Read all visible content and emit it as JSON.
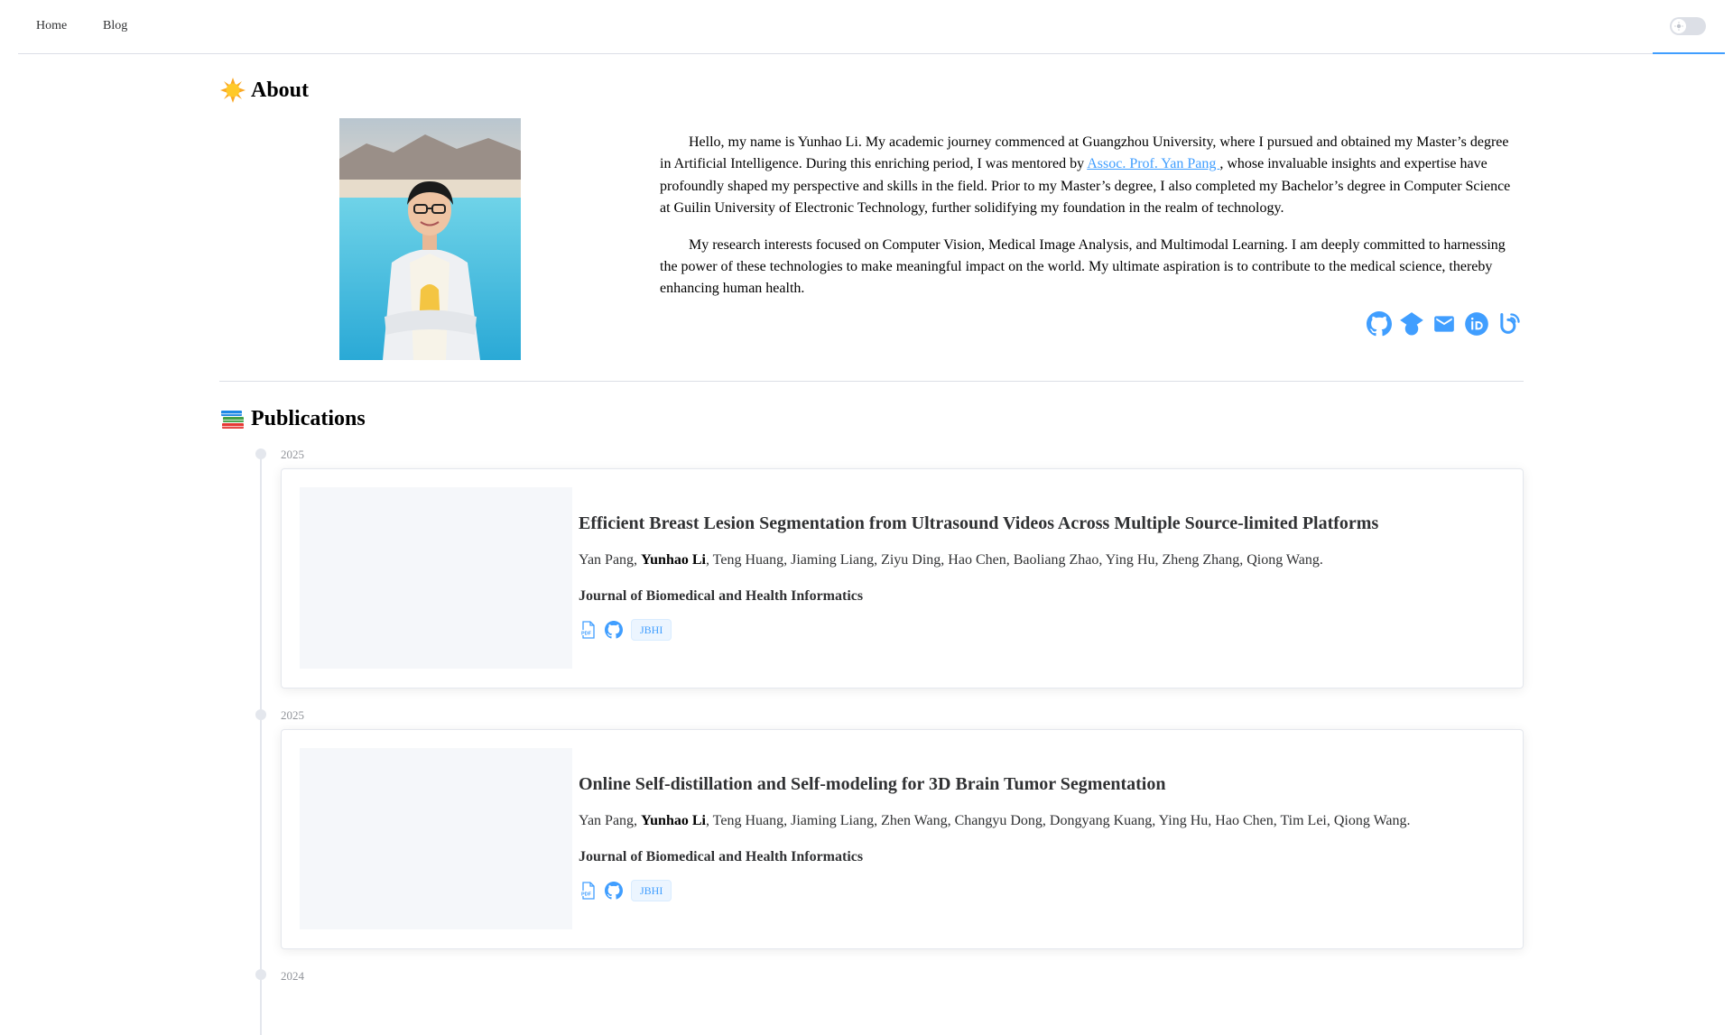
{
  "nav": {
    "home_label": "Home",
    "blog_label": "Blog"
  },
  "colors": {
    "accent": "#409eff",
    "border": "#dcdfe6",
    "text": "#303133",
    "muted": "#909399"
  },
  "about": {
    "title": "About",
    "title_emoji": "sun-with-face-icon",
    "paragraph_1_before_link": "Hello, my name is Yunhao Li. My academic journey commenced at Guangzhou University, where I pursued and obtained my Master’s degree in Artificial Intelligence. During this enriching period, I was mentored by ",
    "mentor_link": "Assoc. Prof. Yan Pang ",
    "paragraph_1_after_link": ", whose invaluable insights and expertise have profoundly shaped my perspective and skills in the field. Prior to my Master’s degree, I also completed my Bachelor’s degree in Computer Science at Guilin University of Electronic Technology, further solidifying my foundation in the realm of technology.",
    "paragraph_2": "My research interests focused on Computer Vision, Medical Image Analysis, and Multimodal Learning. I am deeply committed to harnessing the power of these technologies to make meaningful impact on the world. My ultimate aspiration is to contribute to the medical science, thereby enhancing human health.",
    "social_icons": [
      "github-icon",
      "google-scholar-icon",
      "email-icon",
      "orcid-icon",
      "blog-icon"
    ]
  },
  "publications": {
    "title": "Publications",
    "title_emoji": "books-icon",
    "items": [
      {
        "year": "2025",
        "title": "Efficient Breast Lesion Segmentation from Ultrasound Videos Across Multiple Source-limited Platforms",
        "author_first": "Yan Pang, ",
        "author_self": "Yunhao Li",
        "authors_rest": ", Teng Huang, Jiaming Liang, Ziyu Ding, Hao Chen, Baoliang Zhao, Ying Hu, Zheng Zhang, Qiong Wang.",
        "venue": "Journal of Biomedical and Health Informatics",
        "tag": "JBHI"
      },
      {
        "year": "2025",
        "title": "Online Self-distillation and Self-modeling for 3D Brain Tumor Segmentation",
        "author_first": "Yan Pang, ",
        "author_self": "Yunhao Li",
        "authors_rest": ", Teng Huang, Jiaming Liang, Zhen Wang, Changyu Dong, Dongyang Kuang, Ying Hu, Hao Chen, Tim Lei, Qiong Wang.",
        "venue": "Journal of Biomedical and Health Informatics",
        "tag": "JBHI"
      },
      {
        "year": "2024"
      }
    ]
  }
}
